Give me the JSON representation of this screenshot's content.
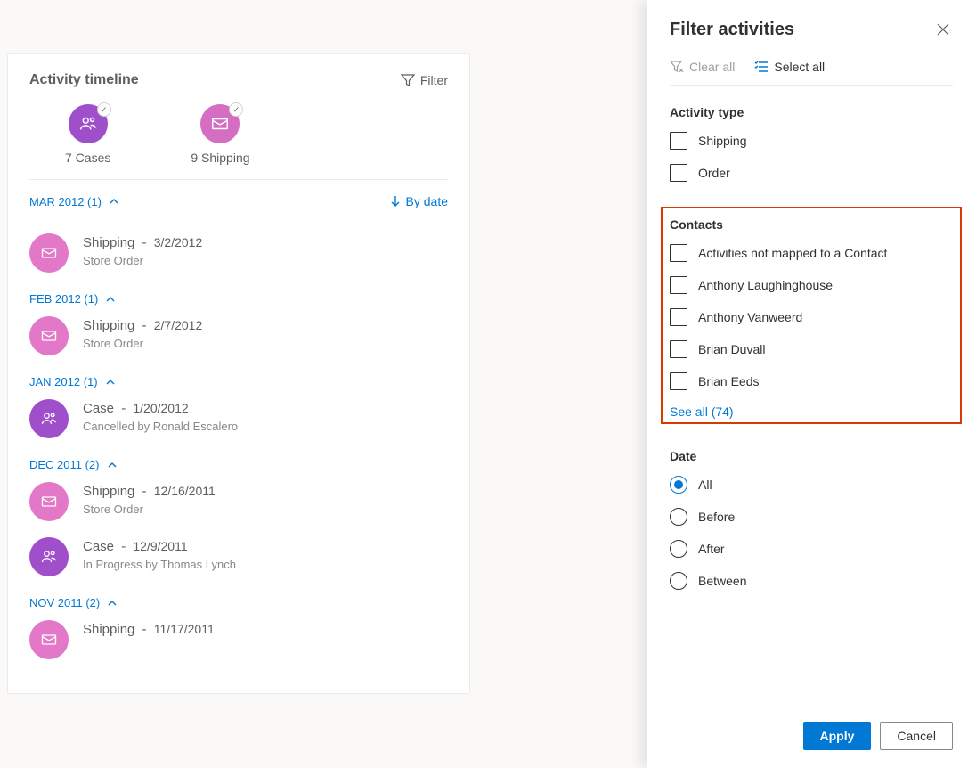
{
  "timeline": {
    "title": "Activity timeline",
    "filter_label": "Filter",
    "summary": [
      {
        "count_label": "7 Cases"
      },
      {
        "count_label": "9 Shipping"
      }
    ],
    "sort_label": "By date",
    "groups": [
      {
        "header": "MAR 2012 (1)",
        "items": [
          {
            "type": "Shipping",
            "date": "3/2/2012",
            "sub": "Store Order",
            "color": "pink",
            "icon": "mail"
          }
        ]
      },
      {
        "header": "FEB 2012 (1)",
        "items": [
          {
            "type": "Shipping",
            "date": "2/7/2012",
            "sub": "Store Order",
            "color": "pink",
            "icon": "mail"
          }
        ]
      },
      {
        "header": "JAN 2012 (1)",
        "items": [
          {
            "type": "Case",
            "date": "1/20/2012",
            "sub": "Cancelled by Ronald Escalero",
            "color": "purple",
            "icon": "person"
          }
        ]
      },
      {
        "header": "DEC 2011 (2)",
        "items": [
          {
            "type": "Shipping",
            "date": "12/16/2011",
            "sub": "Store Order",
            "color": "pink",
            "icon": "mail"
          },
          {
            "type": "Case",
            "date": "12/9/2011",
            "sub": "In Progress by Thomas Lynch",
            "color": "purple",
            "icon": "person"
          }
        ]
      },
      {
        "header": "NOV 2011 (2)",
        "items": [
          {
            "type": "Shipping",
            "date": "11/17/2011",
            "sub": "",
            "color": "pink",
            "icon": "mail"
          }
        ]
      }
    ]
  },
  "panel": {
    "title": "Filter activities",
    "clear_all": "Clear all",
    "select_all": "Select all",
    "sections": {
      "activity_type": {
        "title": "Activity type",
        "options": [
          "Shipping",
          "Order"
        ]
      },
      "contacts": {
        "title": "Contacts",
        "options": [
          "Activities not mapped to a Contact",
          "Anthony Laughinghouse",
          "Anthony Vanweerd",
          "Brian Duvall",
          "Brian Eeds"
        ],
        "see_all": "See all (74)"
      },
      "date": {
        "title": "Date",
        "options": [
          "All",
          "Before",
          "After",
          "Between"
        ],
        "selected": "All"
      }
    },
    "apply": "Apply",
    "cancel": "Cancel"
  }
}
